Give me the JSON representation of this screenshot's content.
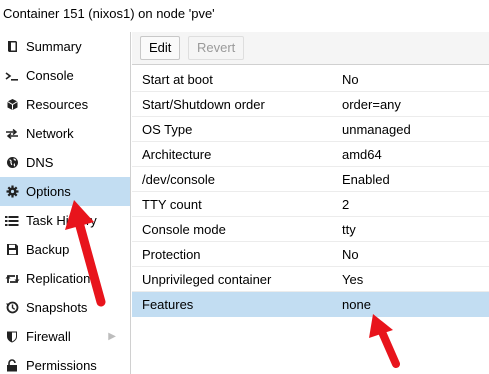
{
  "window": {
    "title": "Container 151 (nixos1) on node 'pve'"
  },
  "sidebar": {
    "items": [
      {
        "label": "Summary",
        "icon": "book-icon"
      },
      {
        "label": "Console",
        "icon": "terminal-icon"
      },
      {
        "label": "Resources",
        "icon": "cube-icon"
      },
      {
        "label": "Network",
        "icon": "exchange-icon"
      },
      {
        "label": "DNS",
        "icon": "globe-icon"
      },
      {
        "label": "Options",
        "icon": "gear-icon"
      },
      {
        "label": "Task History",
        "icon": "list-icon"
      },
      {
        "label": "Backup",
        "icon": "floppy-icon"
      },
      {
        "label": "Replication",
        "icon": "retweet-icon"
      },
      {
        "label": "Snapshots",
        "icon": "history-icon"
      },
      {
        "label": "Firewall",
        "icon": "shield-icon"
      },
      {
        "label": "Permissions",
        "icon": "unlock-icon"
      }
    ],
    "selected": "Options"
  },
  "toolbar": {
    "edit_label": "Edit",
    "revert_label": "Revert"
  },
  "options": {
    "rows": [
      {
        "key": "Start at boot",
        "value": "No"
      },
      {
        "key": "Start/Shutdown order",
        "value": "order=any"
      },
      {
        "key": "OS Type",
        "value": "unmanaged"
      },
      {
        "key": "Architecture",
        "value": "amd64"
      },
      {
        "key": "/dev/console",
        "value": "Enabled"
      },
      {
        "key": "TTY count",
        "value": "2"
      },
      {
        "key": "Console mode",
        "value": "tty"
      },
      {
        "key": "Protection",
        "value": "No"
      },
      {
        "key": "Unprivileged container",
        "value": "Yes"
      },
      {
        "key": "Features",
        "value": "none"
      }
    ],
    "selected": "Features"
  },
  "colors": {
    "selection": "#c2ddf2",
    "annotation_arrow": "#e8141c"
  }
}
